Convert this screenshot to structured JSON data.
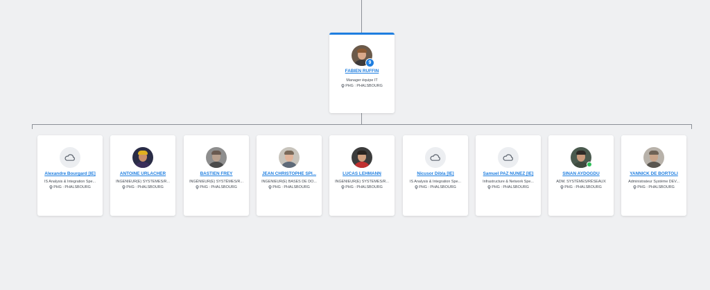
{
  "colors": {
    "background": "#eff0f2",
    "accent": "#1e7ee0",
    "connector": "#8a8f96",
    "card": "#ffffff"
  },
  "manager": {
    "name": "FABIEN RUFFIN",
    "title": "Manager équipe IT",
    "location": "PHG : PHALSBOURG",
    "badge": "9",
    "avatar": "photo"
  },
  "reports": [
    {
      "name": "Alexandre Bourgard [IE]",
      "title": "IS Analysis & Integration Spe...",
      "location": "PHG : PHALSBOURG",
      "avatar": "cloud-icon"
    },
    {
      "name": "ANTOINE URLACHER",
      "title": "INGENIEUR(E) SYSTEMES/R...",
      "location": "PHG : PHALSBOURG",
      "avatar": "photo"
    },
    {
      "name": "BASTIEN FREY",
      "title": "INGÉNIEUR(E) SYSTÈMES/R...",
      "location": "PHG : PHALSBOURG",
      "avatar": "photo"
    },
    {
      "name": "JEAN CHRISTOPHE SPI...",
      "title": "INGENIEUR(E) BASES DE DO...",
      "location": "PHG : PHALSBOURG",
      "avatar": "photo"
    },
    {
      "name": "LUCAS LEHMANN",
      "title": "INGENIEUR(E) SYSTEMES/R...",
      "location": "PHG : PHALSBOURG",
      "avatar": "photo"
    },
    {
      "name": "Nicusor Dibla [IE]",
      "title": "IS Analysis & Integration Spe...",
      "location": "PHG : PHALSBOURG",
      "avatar": "cloud-icon"
    },
    {
      "name": "Samuel PAZ NUNEZ [IE]",
      "title": "Infrastructure & Network Spe...",
      "location": "PHG : PHALSBOURG",
      "avatar": "cloud-icon"
    },
    {
      "name": "SINAN AYDOGDU",
      "title": "ADM. SYSTÈMES/RÉSEAUX",
      "location": "PHG : PHALSBOURG",
      "avatar": "photo"
    },
    {
      "name": "YANNICK DE BORTOLI",
      "title": "Administrateur Système DEV...",
      "location": "PHG : PHALSBOURG",
      "avatar": "photo"
    }
  ]
}
